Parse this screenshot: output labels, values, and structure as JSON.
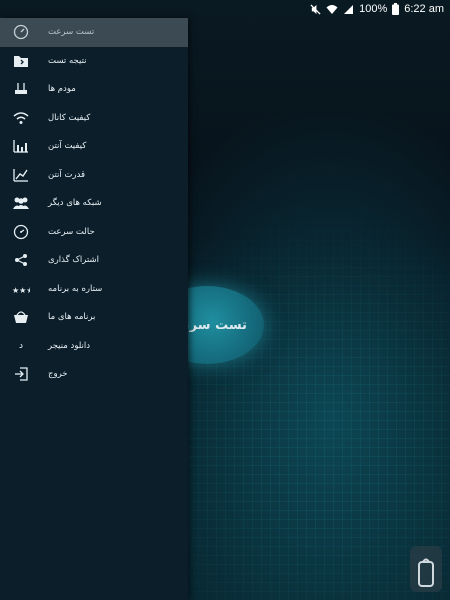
{
  "status_bar": {
    "battery": "100%",
    "time": "6:22 am"
  },
  "main": {
    "go_button_label": "تست سرعت"
  },
  "drawer": {
    "items": [
      {
        "icon": "speedometer-icon",
        "label": "تست سرعت",
        "active": true
      },
      {
        "icon": "folder-icon",
        "label": "نتیجه تست"
      },
      {
        "icon": "router-icon",
        "label": "مودم ها"
      },
      {
        "icon": "wifi-icon",
        "label": "کیفیت کانال"
      },
      {
        "icon": "bar-chart-icon",
        "label": "کیفیت آنتن"
      },
      {
        "icon": "line-chart-icon",
        "label": "قدرت آنتن"
      },
      {
        "icon": "people-icon",
        "label": "شبکه های دیگر"
      },
      {
        "icon": "gauge-icon",
        "label": "حالت سرعت"
      },
      {
        "icon": "share-icon",
        "label": "اشتراک گذاری"
      },
      {
        "icon": "stars-icon",
        "label": "ستاره به برنامه"
      },
      {
        "icon": "basket-icon",
        "label": "برنامه های ما"
      },
      {
        "icon": "letter-d-icon",
        "label": "دانلود منیجر",
        "glyph": "د"
      },
      {
        "icon": "exit-icon",
        "label": "خروج"
      }
    ]
  }
}
